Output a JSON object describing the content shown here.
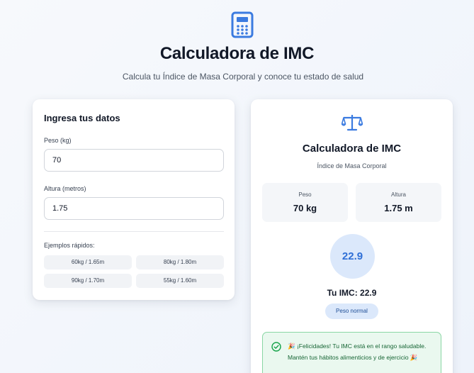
{
  "header": {
    "title": "Calculadora de IMC",
    "subtitle": "Calcula tu Índice de Masa Corporal y conoce tu estado de salud",
    "icon": "calculator-icon"
  },
  "form": {
    "title": "Ingresa tus datos",
    "weight_label": "Peso (kg)",
    "weight_value": "70",
    "height_label": "Altura (metros)",
    "height_value": "1.75",
    "examples_label": "Ejemplos rápidos:",
    "examples": [
      {
        "label": "60kg / 1.65m"
      },
      {
        "label": "80kg / 1.80m"
      },
      {
        "label": "90kg / 1.70m"
      },
      {
        "label": "55kg / 1.60m"
      }
    ]
  },
  "result": {
    "icon": "scale-icon",
    "title": "Calculadora de IMC",
    "subtitle": "Índice de Masa Corporal",
    "weight_label": "Peso",
    "weight_value": "70 kg",
    "height_label": "Altura",
    "height_value": "1.75 m",
    "bmi_value": "22.9",
    "bmi_text": "Tu IMC: 22.9",
    "category": "Peso normal",
    "message": "🎉 ¡Felicidades! Tu IMC está en el rango saludable. Mantén tus hábitos alimenticios y de ejercicio 🎉"
  },
  "colors": {
    "accent": "#2f6fd6",
    "success_border": "#8ad6a4",
    "success_bg": "#eaf8ef",
    "success_text": "#166534"
  }
}
